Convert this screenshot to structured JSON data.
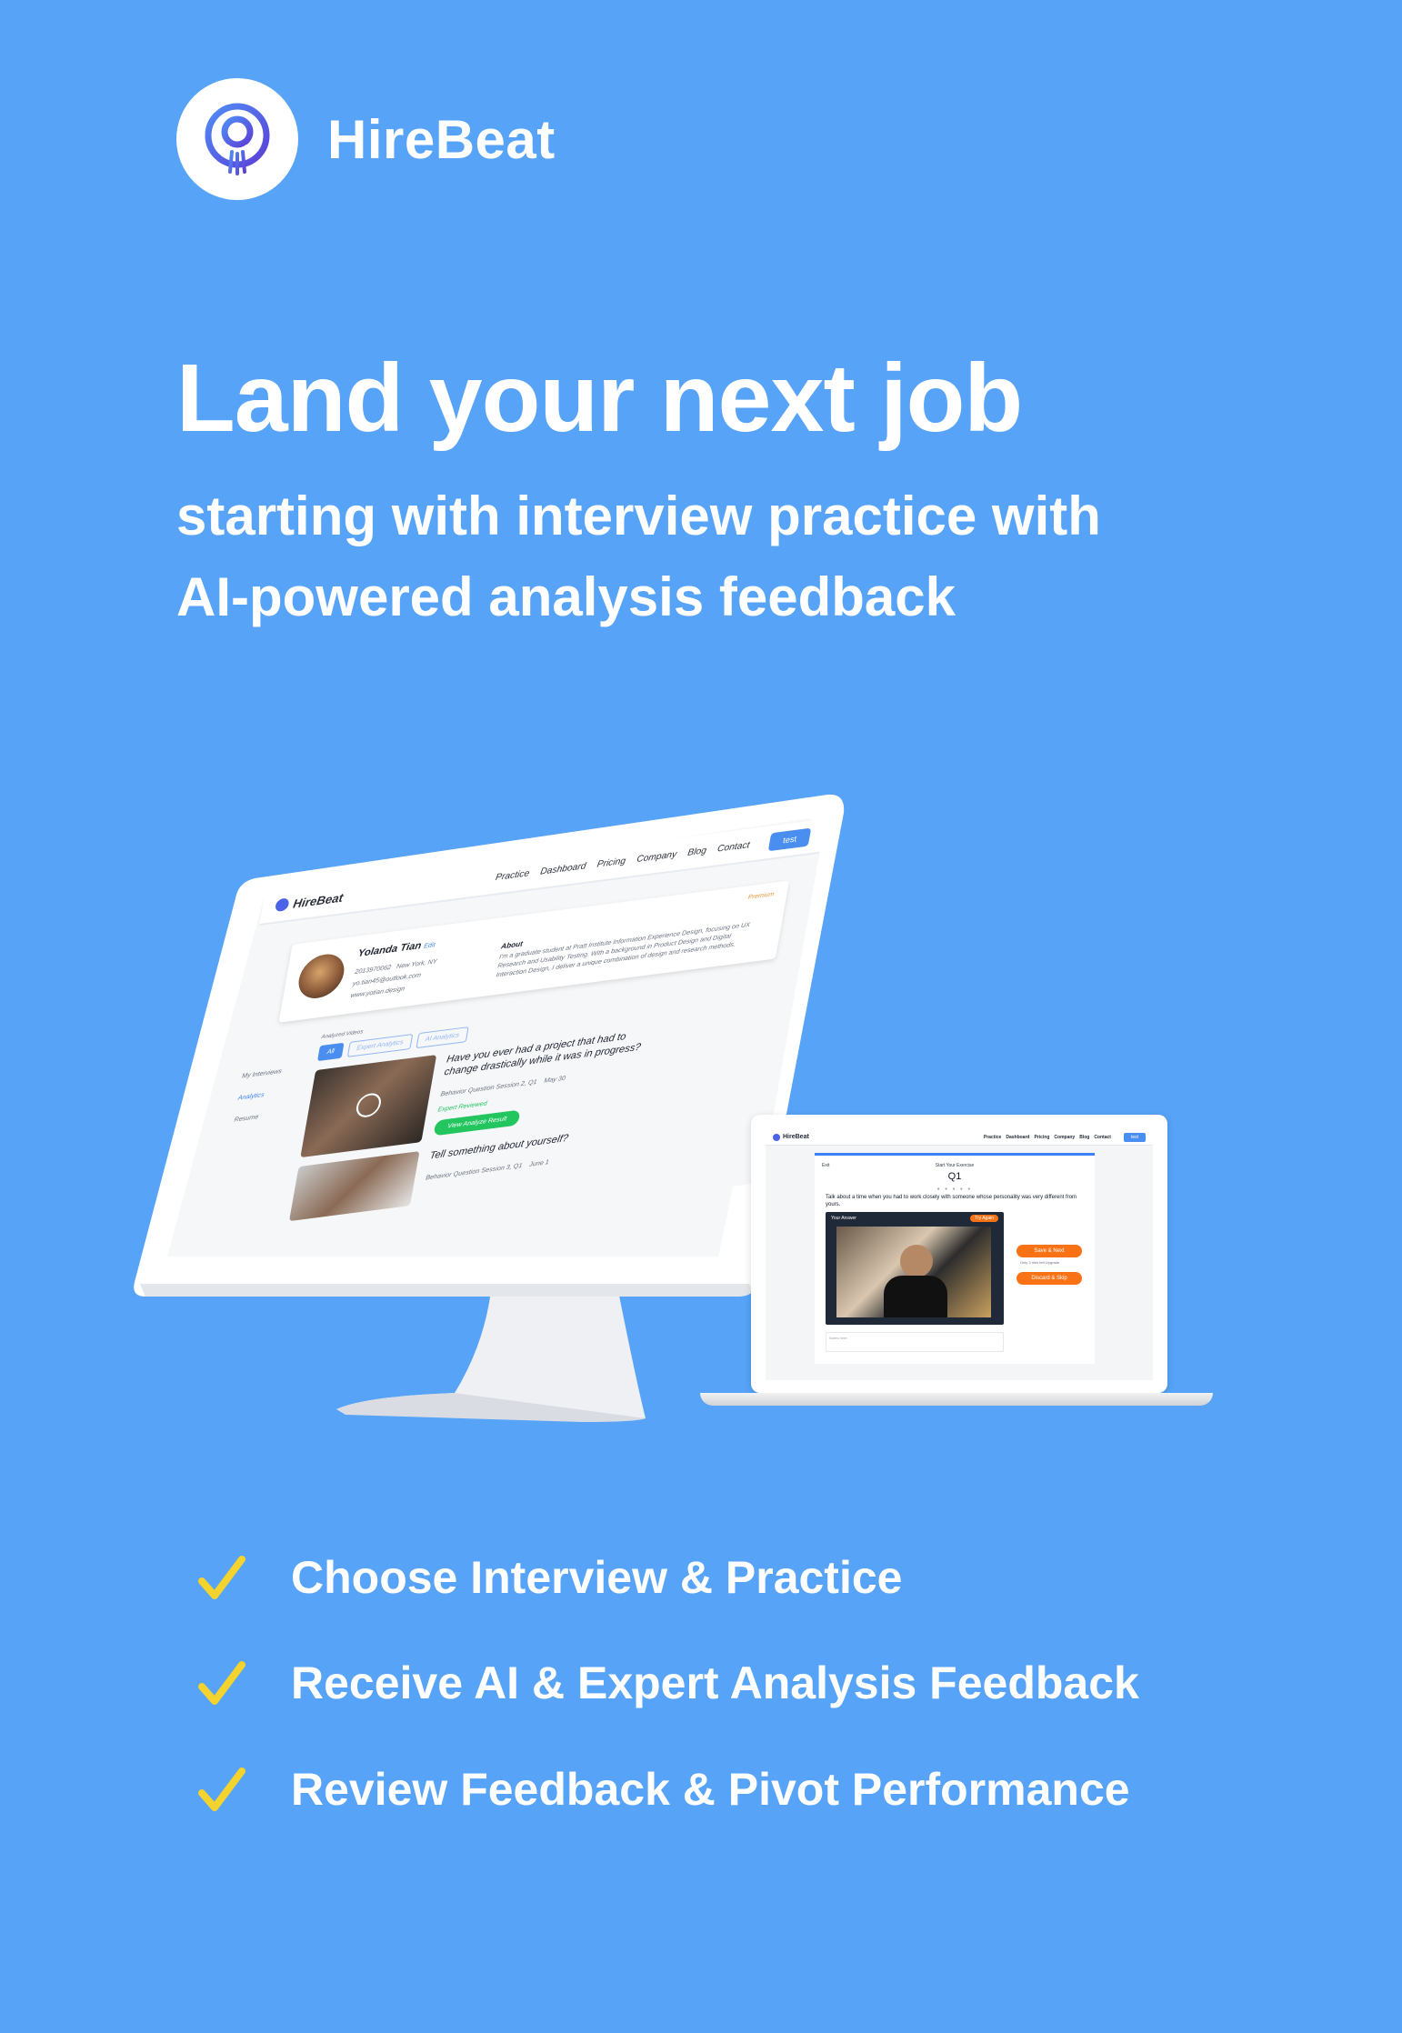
{
  "brand": {
    "name": "HireBeat",
    "logo_icon": "hirebeat-logo-icon"
  },
  "hero": {
    "headline": "Land your next job",
    "subline1": "starting with interview practice with",
    "subline2": "AI-powered analysis feedback"
  },
  "desktop": {
    "logo": "HireBeat",
    "nav": [
      "Practice",
      "Dashboard",
      "Pricing",
      "Company",
      "Blog",
      "Contact"
    ],
    "nav_button": "test",
    "profile": {
      "name": "Yolanda Tian",
      "edit": "Edit",
      "phone": "2013970062",
      "location": "New York, NY",
      "email": "yo.tian45@outlook.com",
      "website": "www.yotian.design",
      "premium": "Premium",
      "about_heading": "About",
      "about_text": "I'm a graduate student at Pratt Institute Information Experience Design, focusing on UX Research and Usability Testing. With a background in Product Design and Digital Interaction Design, I deliver a unique combination of design and research methods."
    },
    "sidebar": [
      "My Interviews",
      "Analytics",
      "Resume"
    ],
    "analyzed_label": "Analyzed Videos",
    "tabs": [
      "All",
      "Expert Analytics",
      "AI Analytics"
    ],
    "videos": [
      {
        "question": "Have you ever had a project that had to change drastically while it was in progress?",
        "category": "Behavior Question Session 2, Q1",
        "date": "May 30",
        "status": "Expert Reviewed",
        "button": "View Analyze Result"
      },
      {
        "question": "Tell something about yourself?",
        "category": "Behavior Question Session 3, Q1",
        "date": "June 1"
      }
    ]
  },
  "laptop": {
    "logo": "HireBeat",
    "nav": [
      "Practice",
      "Dashboard",
      "Pricing",
      "Company",
      "Blog",
      "Contact"
    ],
    "nav_button": "test",
    "exit": "Exit",
    "start": "Start Your Exercise",
    "question_number": "Q1",
    "progress_dots": "● ● ● ● ●",
    "prompt": "Talk about a time when you had to work closely with someone whose personality was very different from yours.",
    "video_label": "Your Answer",
    "try_again": "Try Again",
    "save_next": "Save & Next",
    "subtext": "Only 3 tries left    Upgrade",
    "discard": "Discard & Skip",
    "notes_placeholder": "Notes here"
  },
  "features": [
    "Choose Interview & Practice",
    "Receive AI & Expert Analysis Feedback",
    "Review Feedback & Pivot Performance"
  ],
  "colors": {
    "background": "#56a3f7",
    "accent_check": "#f5d32e",
    "logo_blue": "#4b63e6",
    "orange": "#f97316",
    "green": "#22c55e"
  }
}
